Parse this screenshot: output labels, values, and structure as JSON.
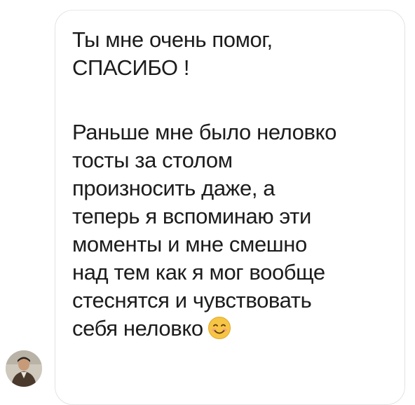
{
  "message": {
    "intro_lines": [
      "Ты мне очень помог,",
      "СПАСИБО !"
    ],
    "body_lines": [
      "Раньше мне было неловко",
      "тосты за столом",
      "произносить даже, а",
      "теперь я вспоминаю эти",
      "моменты и мне смешно",
      "над тем как я мог вообще",
      "стеснятся и чувствовать",
      "себя неловко"
    ],
    "emoji": "smiling-face-icon"
  },
  "sender": {
    "avatar": "sender-avatar"
  },
  "colors": {
    "text": "#1c1c1c",
    "bubble_border": "#e3e3e3",
    "background": "#ffffff",
    "emoji_face": "#f7c544"
  }
}
